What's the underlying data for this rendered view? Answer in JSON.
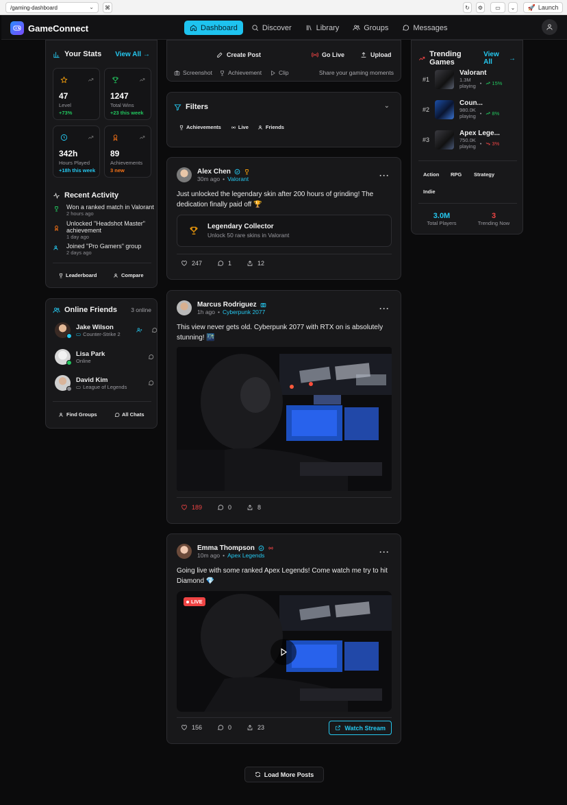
{
  "browser": {
    "url": "/gaming-dashboard",
    "launch_label": "Launch"
  },
  "app": {
    "name": "GameConnect",
    "nav": [
      {
        "label": "Dashboard",
        "icon": "home-icon",
        "active": true
      },
      {
        "label": "Discover",
        "icon": "search-icon",
        "active": false
      },
      {
        "label": "Library",
        "icon": "library-icon",
        "active": false
      },
      {
        "label": "Groups",
        "icon": "users-icon",
        "active": false
      },
      {
        "label": "Messages",
        "icon": "message-icon",
        "active": false
      }
    ]
  },
  "stats": {
    "title": "Your Stats",
    "view_all": "View All",
    "items": [
      {
        "value": "47",
        "label": "Level",
        "change": "+73%",
        "color": "#22c55e",
        "icon": "star-icon"
      },
      {
        "value": "1247",
        "label": "Total Wins",
        "change": "+23 this week",
        "color": "#22c55e",
        "icon": "trophy-icon"
      },
      {
        "value": "342h",
        "label": "Hours Played",
        "change": "+18h this week",
        "color": "#25c8f0",
        "icon": "clock-icon"
      },
      {
        "value": "89",
        "label": "Achievements",
        "change": "3 new",
        "color": "#f97316",
        "icon": "medal-icon"
      }
    ]
  },
  "activity": {
    "title": "Recent Activity",
    "items": [
      {
        "text": "Won a ranked match in Valorant",
        "time": "2 hours ago",
        "icon": "trophy-icon"
      },
      {
        "text": "Unlocked \"Headshot Master\" achievement",
        "time": "1 day ago",
        "icon": "medal-icon"
      },
      {
        "text": "Joined \"Pro Gamers\" group",
        "time": "2 days ago",
        "icon": "users-icon"
      }
    ],
    "leaderboard": "Leaderboard",
    "compare": "Compare"
  },
  "friends": {
    "title": "Online Friends",
    "count": "3 online",
    "items": [
      {
        "name": "Jake Wilson",
        "status": "Counter-Strike 2"
      },
      {
        "name": "Lisa Park",
        "status": "Online"
      },
      {
        "name": "David Kim",
        "status": "League of Legends"
      }
    ],
    "find_groups": "Find Groups",
    "all_chats": "All Chats"
  },
  "composer": {
    "create_post": "Create Post",
    "go_live": "Go Live",
    "upload": "Upload",
    "screenshot": "Screenshot",
    "achievement": "Achievement",
    "clip": "Clip",
    "hint": "Share your gaming moments"
  },
  "filters": {
    "title": "Filters",
    "chips": [
      "Achievements",
      "Live",
      "Friends"
    ]
  },
  "posts": [
    {
      "author": "Alex Chen",
      "time": "30m ago",
      "game": "Valorant",
      "text": "Just unlocked the legendary skin after 200 hours of grinding! The dedication finally paid off 🏆",
      "achievement_title": "Legendary Collector",
      "achievement_desc": "Unlock 50 rare skins in Valorant",
      "likes": "247",
      "comments": "1",
      "shares": "12"
    },
    {
      "author": "Marcus Rodriguez",
      "time": "1h ago",
      "game": "Cyberpunk 2077",
      "text": "This view never gets old. Cyberpunk 2077 with RTX on is absolutely stunning! 🌃",
      "likes": "189",
      "comments": "0",
      "shares": "8"
    },
    {
      "author": "Emma Thompson",
      "time": "10m ago",
      "game": "Apex Legends",
      "text": "Going live with some ranked Apex Legends! Come watch me try to hit Diamond 💎",
      "live_badge": "LIVE",
      "likes": "156",
      "comments": "0",
      "shares": "23",
      "watch": "Watch Stream"
    }
  ],
  "load_more": "Load More Posts",
  "trending": {
    "title": "Trending Games",
    "view_all": "View All",
    "items": [
      {
        "rank": "#1",
        "name": "Valorant",
        "players": "1.3M",
        "playing": "playing",
        "change": "15%",
        "color": "#22c55e"
      },
      {
        "rank": "#2",
        "name": "Coun...",
        "players": "980.0K",
        "playing": "playing",
        "change": "8%",
        "color": "#22c55e"
      },
      {
        "rank": "#3",
        "name": "Apex Lege...",
        "players": "750.0K",
        "playing": "playing",
        "change": "3%",
        "color": "#ef4444"
      }
    ],
    "genres": [
      "Action",
      "RPG",
      "Strategy",
      "Indie"
    ],
    "total_players": "3.0M",
    "total_label": "Total Players",
    "trending_now": "3",
    "trending_label": "Trending Now"
  }
}
